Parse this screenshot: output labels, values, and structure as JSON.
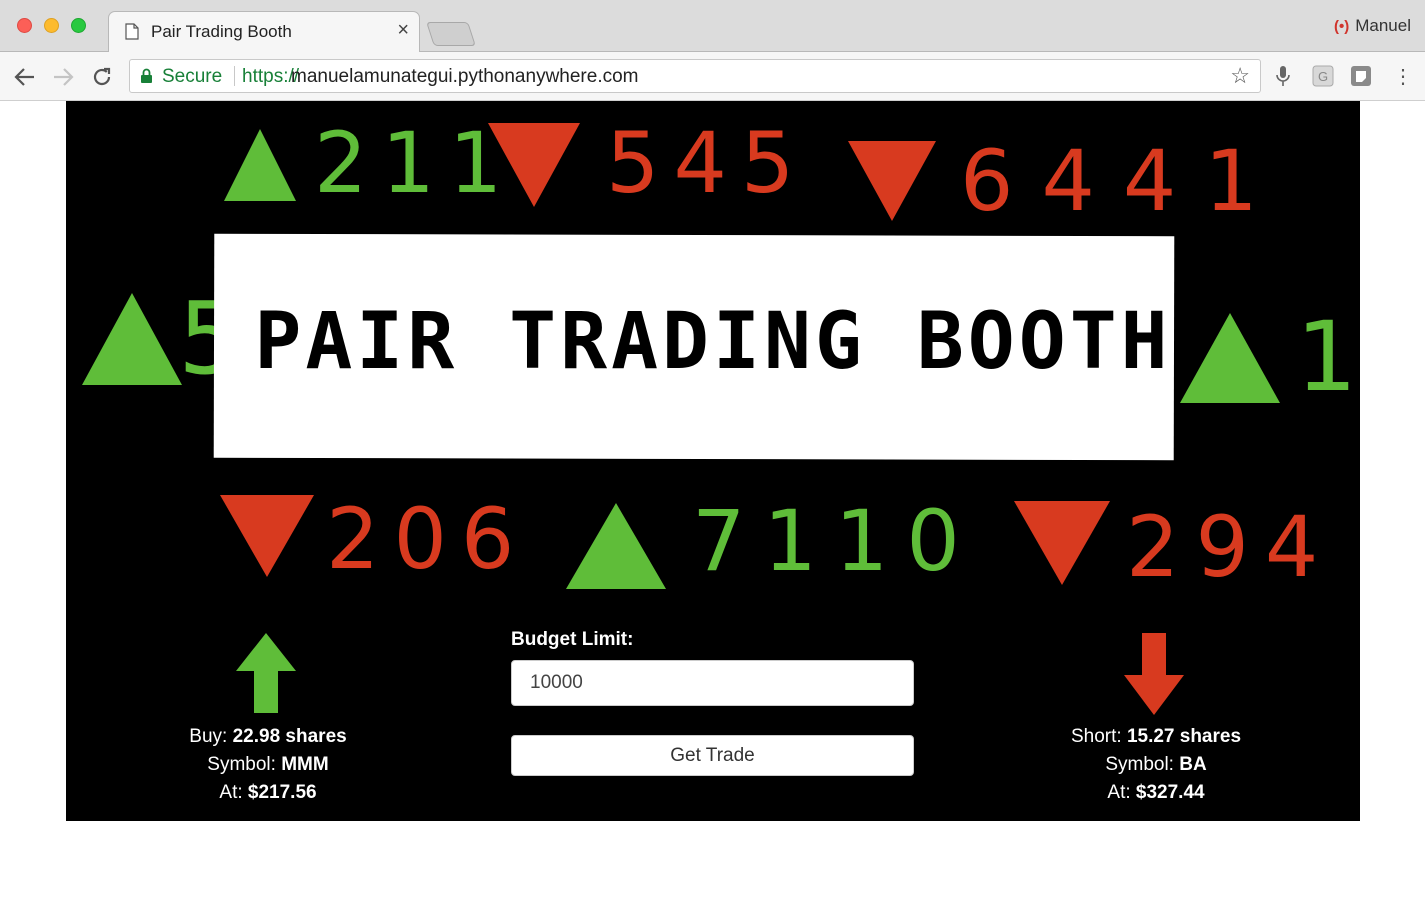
{
  "browser": {
    "tab_title": "Pair Trading Booth",
    "profile_name": "Manuel",
    "secure_label": "Secure",
    "url_scheme": "https://",
    "url_host": "manuelamunategui.pythonanywhere.com"
  },
  "ticker": {
    "top_row": [
      {
        "direction": "up",
        "value": "211"
      },
      {
        "direction": "down",
        "value": "545"
      },
      {
        "direction": "down",
        "value": "6441"
      }
    ],
    "left": {
      "direction": "up",
      "value": "5"
    },
    "right": {
      "direction": "up",
      "value": "1"
    },
    "bottom_row": [
      {
        "direction": "down",
        "value": "206"
      },
      {
        "direction": "up",
        "value": "7110"
      },
      {
        "direction": "down",
        "value": "294"
      }
    ],
    "up_color": "#5fbd39",
    "down_color": "#d83a1f"
  },
  "banner": {
    "title": "PAIR TRADING BOOTH"
  },
  "form": {
    "budget_label": "Budget Limit:",
    "budget_value": "10000",
    "submit_label": "Get Trade"
  },
  "buy": {
    "action_label": "Buy:",
    "shares": "22.98 shares",
    "symbol_label": "Symbol:",
    "symbol": "MMM",
    "at_label": "At:",
    "price": "$217.56"
  },
  "short": {
    "action_label": "Short:",
    "shares": "15.27 shares",
    "symbol_label": "Symbol:",
    "symbol": "BA",
    "at_label": "At:",
    "price": "$327.44"
  }
}
